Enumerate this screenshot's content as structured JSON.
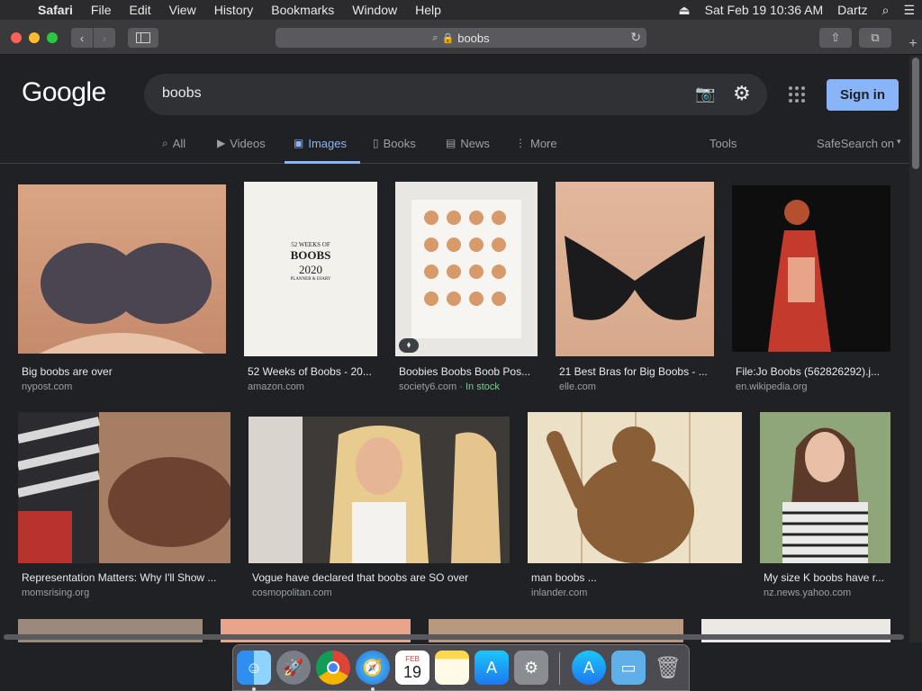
{
  "menubar": {
    "app": "Safari",
    "items": [
      "File",
      "Edit",
      "View",
      "History",
      "Bookmarks",
      "Window",
      "Help"
    ],
    "datetime": "Sat Feb 19  10:36 AM",
    "user": "Dartz"
  },
  "toolbar": {
    "address": "boobs"
  },
  "google": {
    "logo": "Google",
    "query": "boobs",
    "signin": "Sign in",
    "tabs": {
      "all": "All",
      "videos": "Videos",
      "images": "Images",
      "books": "Books",
      "news": "News",
      "more": "More",
      "tools": "Tools"
    },
    "safesearch": "SafeSearch on"
  },
  "results": [
    {
      "caption": "Big boobs are over",
      "source": "nypost.com"
    },
    {
      "caption": "52 Weeks of Boobs - 20...",
      "source": "amazon.com"
    },
    {
      "caption": "Boobies Boobs Boob Pos...",
      "source": "society6.com",
      "stock": "In stock"
    },
    {
      "caption": "21 Best Bras for Big Boobs - ...",
      "source": "elle.com"
    },
    {
      "caption": "File:Jo Boobs (562826292).j...",
      "source": "en.wikipedia.org"
    },
    {
      "caption": "Representation Matters: Why I'll Show ...",
      "source": "momsrising.org"
    },
    {
      "caption": "Vogue have declared that boobs are SO over",
      "source": "cosmopolitan.com"
    },
    {
      "caption": "man boobs ...",
      "source": "inlander.com"
    },
    {
      "caption": "My size K boobs have r...",
      "source": "nz.news.yahoo.com"
    }
  ],
  "poster": {
    "line1": "52 WEEKS OF",
    "line2": "BOOBS",
    "line3": "2020",
    "line4": "PLANNER & DIARY"
  },
  "dock": {
    "calendar_month": "FEB",
    "calendar_day": "19"
  }
}
